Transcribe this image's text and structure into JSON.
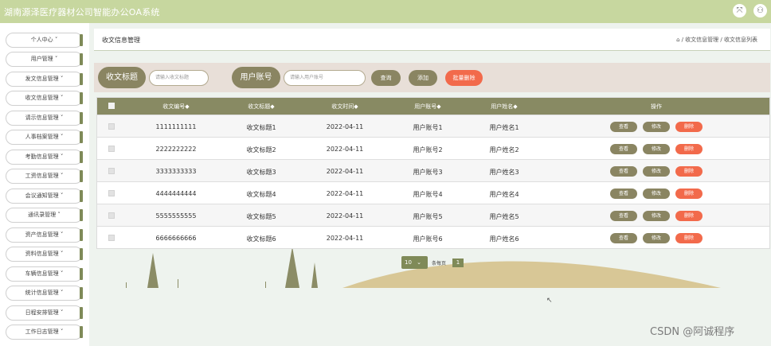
{
  "app": {
    "title": "湖南源泽医疗器材公司智能办公OA系统"
  },
  "topbar": {
    "fullscreen_icon": "⤧",
    "user_icon": "⚇"
  },
  "sidebar": {
    "items": [
      {
        "label": "个人中心 ˅"
      },
      {
        "label": "用户管理 ˅"
      },
      {
        "label": "发文信息管理 ˅"
      },
      {
        "label": "收文信息管理 ˅"
      },
      {
        "label": "请示信息管理 ˅"
      },
      {
        "label": "人事档案管理 ˅"
      },
      {
        "label": "考勤信息管理 ˅"
      },
      {
        "label": "工资信息管理 ˅"
      },
      {
        "label": "会议通知管理 ˅"
      },
      {
        "label": "通讯录管理 ˅"
      },
      {
        "label": "资产信息管理 ˅"
      },
      {
        "label": "资料信息管理 ˅"
      },
      {
        "label": "车辆信息管理 ˅"
      },
      {
        "label": "统计信息管理 ˅"
      },
      {
        "label": "日程安排管理 ˅"
      },
      {
        "label": "工作日志管理 ˅"
      }
    ]
  },
  "header": {
    "page_title": "收文信息管理",
    "home_icon": "⌂",
    "breadcrumb": "/ 收文信息管理 / 收文信息列表"
  },
  "search": {
    "title_label": "收文标题",
    "title_placeholder": "请输入收文标题",
    "account_label": "用户账号",
    "account_placeholder": "请输入用户账号",
    "query_btn": "查询",
    "add_btn": "添加",
    "batch_delete_btn": "批量删除"
  },
  "table": {
    "headers": [
      "收文编号◆",
      "收文标题◆",
      "收文时间◆",
      "用户账号◆",
      "用户姓名◆",
      "操作"
    ],
    "actions": {
      "view": "查看",
      "edit": "修改",
      "delete": "删除"
    },
    "rows": [
      [
        "1111111111",
        "收文标题1",
        "2022-04-11",
        "用户账号1",
        "用户姓名1"
      ],
      [
        "2222222222",
        "收文标题2",
        "2022-04-11",
        "用户账号2",
        "用户姓名2"
      ],
      [
        "3333333333",
        "收文标题3",
        "2022-04-11",
        "用户账号3",
        "用户姓名3"
      ],
      [
        "4444444444",
        "收文标题4",
        "2022-04-11",
        "用户账号4",
        "用户姓名4"
      ],
      [
        "5555555555",
        "收文标题5",
        "2022-04-11",
        "用户账号5",
        "用户姓名5"
      ],
      [
        "6666666666",
        "收文标题6",
        "2022-04-11",
        "用户账号6",
        "用户姓名6"
      ]
    ]
  },
  "pagination": {
    "page_size": "10",
    "chevron": "⌄",
    "per_page_label": "条每页",
    "current_page": "1"
  },
  "watermark": "CSDN @阿诚程序",
  "colors": {
    "accent": "#8a8562",
    "danger": "#f26a4b",
    "topbar": "#c7d79f"
  }
}
